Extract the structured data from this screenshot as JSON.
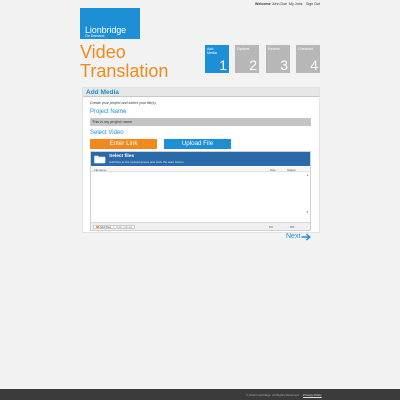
{
  "topbar": {
    "welcome_label": "Welcome",
    "user_name": "John Doe",
    "my_jobs": "My Jobs",
    "sign_out": "Sign Out"
  },
  "logo": {
    "brand": "Lionbridge",
    "sub": "On Demand"
  },
  "page": {
    "title_line1": "Video",
    "title_line2": "Translation"
  },
  "steps": [
    {
      "label_line1": "Add",
      "label_line2": "Media",
      "number": "1",
      "active": true
    },
    {
      "label_line1": "Options",
      "label_line2": "",
      "number": "2",
      "active": false
    },
    {
      "label_line1": "Review",
      "label_line2": "",
      "number": "3",
      "active": false
    },
    {
      "label_line1": "Checkout",
      "label_line2": "",
      "number": "4",
      "active": false
    }
  ],
  "panel": {
    "header": "Add Media",
    "instruction": "Create your project and select your file(s)",
    "project_name_label": "Project Name",
    "project_name_value": "This is my project name",
    "select_video_label": "Select Video",
    "enter_link_label": "Enter Link",
    "upload_file_label": "Upload File"
  },
  "uploader": {
    "title": "Select files",
    "subtitle": "Add files to the upload queue and click the start button.",
    "columns": {
      "filename": "Filename",
      "size": "Size",
      "status": "Status"
    },
    "add_files_label": "Add files",
    "start_upload_label": "Start upload",
    "total_size": "0 b",
    "total_percent": "0%"
  },
  "nav": {
    "next_label": "Next"
  },
  "footer": {
    "copyright": "© 2012 Lionbridge. All Rights Reserved.",
    "privacy": "Privacy Policy"
  },
  "colors": {
    "brand_blue": "#1d8fd6",
    "accent_orange": "#f08a1c",
    "inactive_step": "#b7b7b7",
    "uploader_header": "#2b6aa8"
  }
}
